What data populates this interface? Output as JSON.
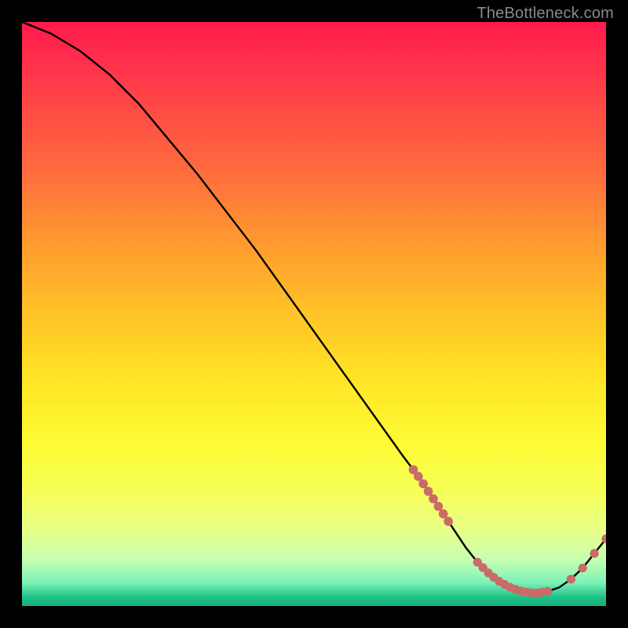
{
  "watermark": "TheBottleneck.com",
  "chart_data": {
    "type": "line",
    "title": "",
    "xlabel": "",
    "ylabel": "",
    "xlim": [
      0,
      100
    ],
    "ylim": [
      0,
      100
    ],
    "series": [
      {
        "name": "bottleneck-curve",
        "x": [
          0,
          5,
          10,
          15,
          20,
          25,
          30,
          35,
          40,
          45,
          50,
          55,
          60,
          65,
          68,
          70,
          72,
          74,
          76,
          78,
          80,
          82,
          84,
          86,
          88,
          90,
          92,
          94,
          96,
          98,
          100
        ],
        "values": [
          100,
          98,
          95,
          91,
          86,
          80,
          74,
          67.5,
          61,
          54,
          47,
          40,
          33,
          26,
          22,
          19,
          16,
          13,
          10,
          7.5,
          5.5,
          4,
          3,
          2.4,
          2.2,
          2.5,
          3.2,
          4.6,
          6.5,
          9,
          11.5
        ]
      }
    ],
    "marker_clusters": [
      {
        "name": "cluster-left",
        "x_range": [
          67,
          73
        ],
        "y_range": [
          16,
          22
        ],
        "density": "medium"
      },
      {
        "name": "cluster-floor",
        "x_range": [
          78,
          90
        ],
        "y_range": [
          2,
          4
        ],
        "density": "high"
      },
      {
        "name": "cluster-right",
        "x_range": [
          94,
          100
        ],
        "y_range": [
          7,
          12
        ],
        "density": "low"
      }
    ],
    "marker_color": "#c96b68",
    "line_color": "#000000"
  }
}
